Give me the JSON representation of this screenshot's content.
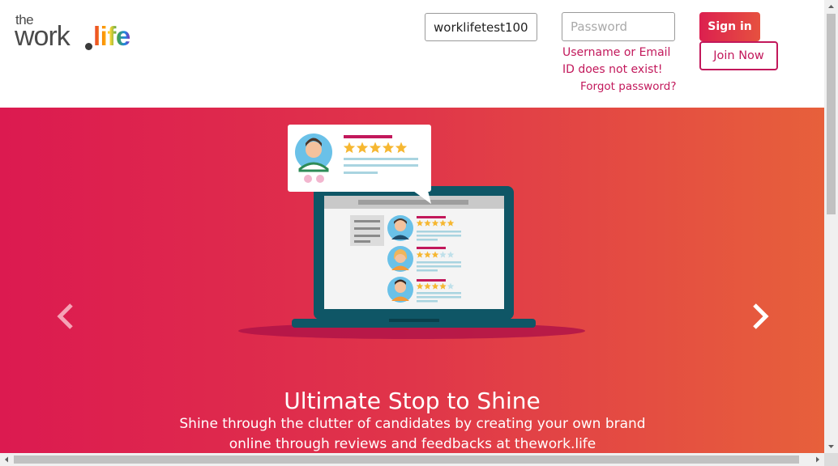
{
  "header": {
    "logo": {
      "the": "the",
      "work": "work",
      "life": "life"
    },
    "username_value": "worklifetest100",
    "password_placeholder": "Password",
    "error_message": "Username or Email ID does not exist!",
    "forgot_password": "Forgot password?",
    "signin_label": "Sign in",
    "join_label": "Join Now"
  },
  "hero": {
    "title": "Ultimate Stop to Shine",
    "subtitle": "Shine through the clutter of candidates by creating your own brand online through reviews and feedbacks at thework.life",
    "colors": {
      "gradient_start": "#dc1a50",
      "gradient_end": "#e7603b"
    },
    "ratings": {
      "popup": 5,
      "row1": 5,
      "row2": 3,
      "row3": 4,
      "max": 5
    },
    "prev_icon": "chevron-left-icon",
    "next_icon": "chevron-right-icon"
  },
  "accent_color": "#c2185b"
}
